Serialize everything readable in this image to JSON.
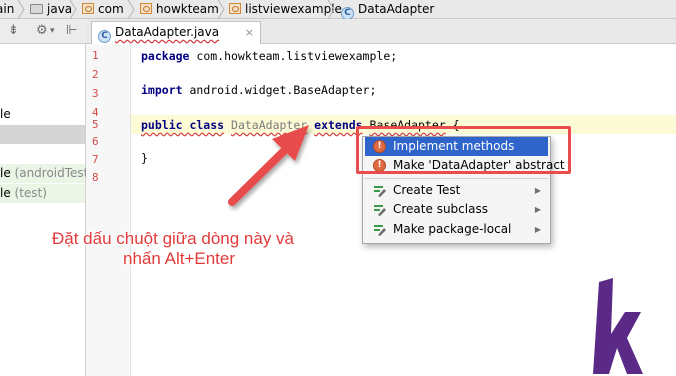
{
  "breadcrumb": {
    "items": [
      {
        "label": "ain",
        "icon": "folder-icon"
      },
      {
        "label": "java",
        "icon": "folder-icon"
      },
      {
        "label": "com",
        "icon": "package-icon"
      },
      {
        "label": "howkteam",
        "icon": "package-icon"
      },
      {
        "label": "listviewexample",
        "icon": "package-icon"
      },
      {
        "label": "DataAdapter",
        "icon": "class-icon"
      }
    ]
  },
  "left_panel": {
    "rows": [
      {
        "text": "le",
        "muted": ""
      },
      {
        "text": "le",
        "muted": " (androidTest)"
      },
      {
        "text": "le",
        "muted": " (test)"
      }
    ]
  },
  "tab": {
    "label": "DataAdapter.java",
    "close": "×",
    "icon_letter": "C"
  },
  "editor": {
    "line_numbers": [
      "1",
      "2",
      "3",
      "4",
      "5",
      "6",
      "7",
      "8"
    ],
    "line1": {
      "kw": "package",
      "rest": " com.howkteam.listviewexample;"
    },
    "line3": {
      "kw": "import",
      "rest": " android.widget.BaseAdapter;"
    },
    "line5": {
      "kw1": "public class",
      "name": "DataAdapter",
      "kw2": "extends",
      "parent": "BaseAdapter",
      "brace": " {"
    },
    "line7": "}"
  },
  "popup": {
    "items": [
      {
        "label": "Implement methods",
        "icon": "bulb-icon",
        "selected": true,
        "submenu": false
      },
      {
        "label": "Make 'DataAdapter' abstract",
        "icon": "bulb-icon",
        "selected": false,
        "submenu": false
      },
      {
        "label": "Create Test",
        "icon": "pencil-icon",
        "selected": false,
        "submenu": true
      },
      {
        "label": "Create subclass",
        "icon": "pencil-icon",
        "selected": false,
        "submenu": true
      },
      {
        "label": "Make package-local",
        "icon": "pencil-icon",
        "selected": false,
        "submenu": true
      }
    ]
  },
  "annotation": {
    "line1": "Đặt dấu chuột giữa dòng này và",
    "line2": "nhấn Alt+Enter"
  },
  "colors": {
    "accent": "#e84c4c",
    "selection": "#2f65ca",
    "logo": "#5b2a86"
  }
}
